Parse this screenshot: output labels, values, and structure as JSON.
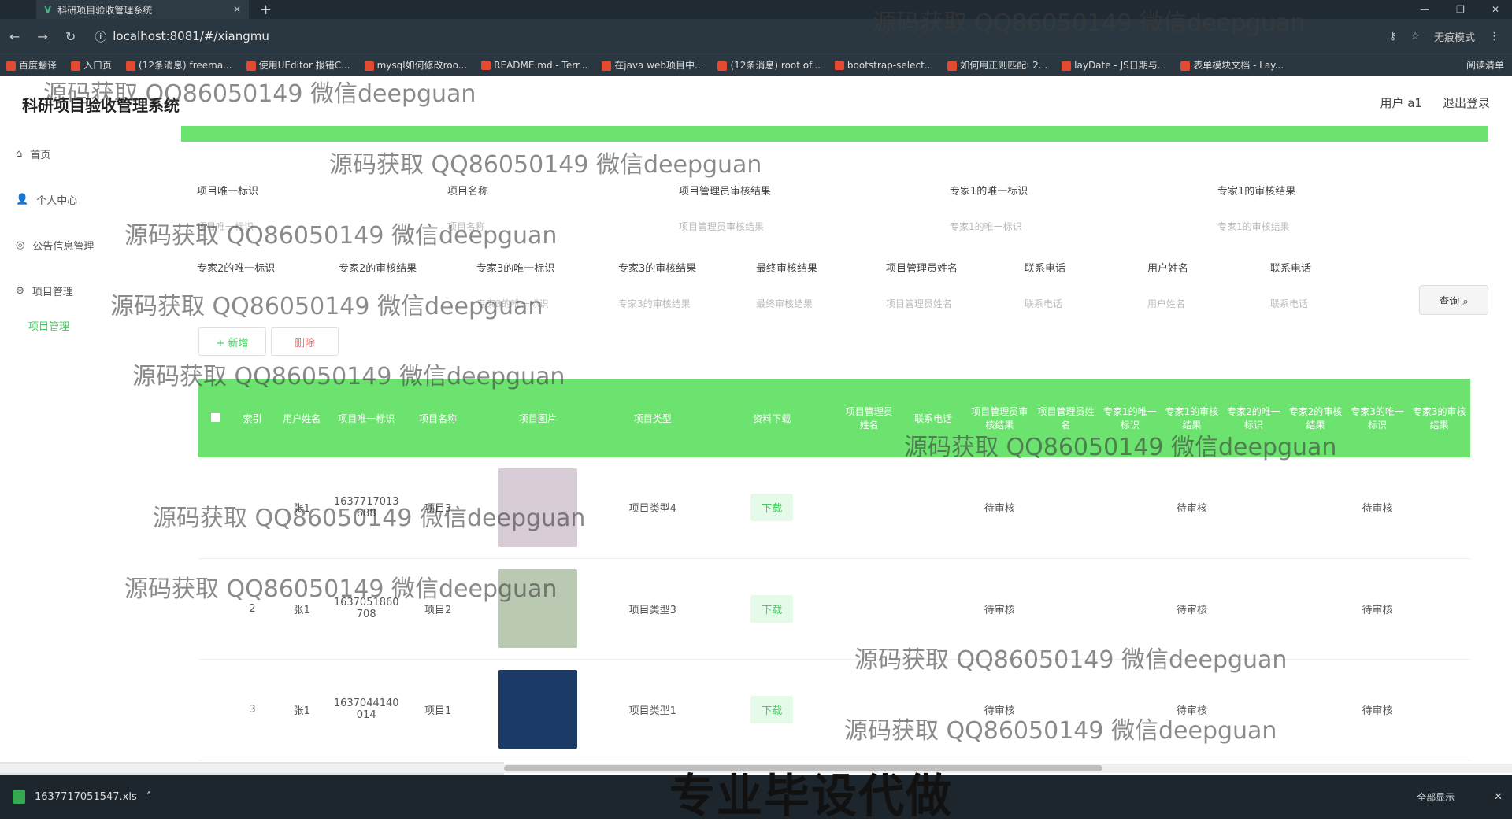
{
  "browser": {
    "tab_title": "科研项目验收管理系统",
    "url": "localhost:8081/#/xiangmu",
    "incognito_label": "无痕模式",
    "reading_list": "阅读清单",
    "bookmarks": [
      "百度翻译",
      "入口页",
      "(12条消息) freema...",
      "使用UEditor 报错C...",
      "mysql如何修改roo...",
      "README.md - Terr...",
      "在java web项目中...",
      "(12条消息) root of...",
      "bootstrap-select...",
      "如何用正则匹配: 2...",
      "layDate - JS日期与...",
      "表单模块文档 - Lay..."
    ]
  },
  "app": {
    "title": "科研项目验收管理系统",
    "user_label": "用户 a1",
    "logout": "退出登录"
  },
  "sidebar": {
    "items": [
      {
        "label": "首页",
        "icon": "home-icon"
      },
      {
        "label": "个人中心",
        "icon": "user-icon"
      },
      {
        "label": "公告信息管理",
        "icon": "notice-icon"
      },
      {
        "label": "项目管理",
        "icon": "project-icon"
      }
    ],
    "sub_item": "项目管理"
  },
  "filters": {
    "row1": [
      {
        "label": "项目唯一标识",
        "placeholder": "项目唯一标识"
      },
      {
        "label": "项目名称",
        "placeholder": "项目名称"
      },
      {
        "label": "项目管理员审核结果",
        "placeholder": "项目管理员审核结果"
      },
      {
        "label": "专家1的唯一标识",
        "placeholder": "专家1的唯一标识"
      },
      {
        "label": "专家1的审核结果",
        "placeholder": "专家1的审核结果"
      }
    ],
    "row2": [
      {
        "label": "专家2的唯一标识",
        "placeholder": ""
      },
      {
        "label": "专家2的审核结果",
        "placeholder": ""
      },
      {
        "label": "专家3的唯一标识",
        "placeholder": "专家3的唯一标识"
      },
      {
        "label": "专家3的审核结果",
        "placeholder": "专家3的审核结果"
      },
      {
        "label": "最终审核结果",
        "placeholder": "最终审核结果"
      },
      {
        "label": "项目管理员姓名",
        "placeholder": "项目管理员姓名"
      },
      {
        "label": "联系电话",
        "placeholder": "联系电话"
      },
      {
        "label": "用户姓名",
        "placeholder": "用户姓名"
      },
      {
        "label": "联系电话",
        "placeholder": "联系电话"
      }
    ],
    "search": "查询"
  },
  "actions": {
    "add": "+ 新增",
    "delete": "删除"
  },
  "table": {
    "headers": [
      "索引",
      "用户姓名",
      "项目唯一标识",
      "项目名称",
      "项目图片",
      "项目类型",
      "资料下载",
      "项目管理员姓名",
      "联系电话",
      "项目管理员审核结果",
      "项目管理员姓名",
      "专家1的唯一标识",
      "专家1的审核结果",
      "专家2的唯一标识",
      "专家2的审核结果",
      "专家3的唯一标识",
      "专家3的审核结果"
    ],
    "rows": [
      {
        "index": "",
        "user": "张1",
        "id": "1637717013688",
        "name": "项目3",
        "type": "项目类型4",
        "download": "下载",
        "s1": "待审核",
        "s2": "待审核",
        "s3": "待审核",
        "img": "#d8ccd6"
      },
      {
        "index": "2",
        "user": "张1",
        "id": "1637051860708",
        "name": "项目2",
        "type": "项目类型3",
        "download": "下载",
        "s1": "待审核",
        "s2": "待审核",
        "s3": "待审核",
        "img": "#b9c9b2"
      },
      {
        "index": "3",
        "user": "张1",
        "id": "1637044140014",
        "name": "项目1",
        "type": "项目类型1",
        "download": "下载",
        "s1": "待审核",
        "s2": "待审核",
        "s3": "待审核",
        "img": "#1c3a66"
      }
    ]
  },
  "download_bar": {
    "file": "1637717051547.xls",
    "show_all": "全部显示"
  },
  "caption": "专业毕设代做",
  "watermark": "源码获取 QQ86050149 微信deepguan",
  "colors": {
    "accent": "#6ce36f",
    "link": "#3fcf5c",
    "danger": "#f56c6c"
  }
}
